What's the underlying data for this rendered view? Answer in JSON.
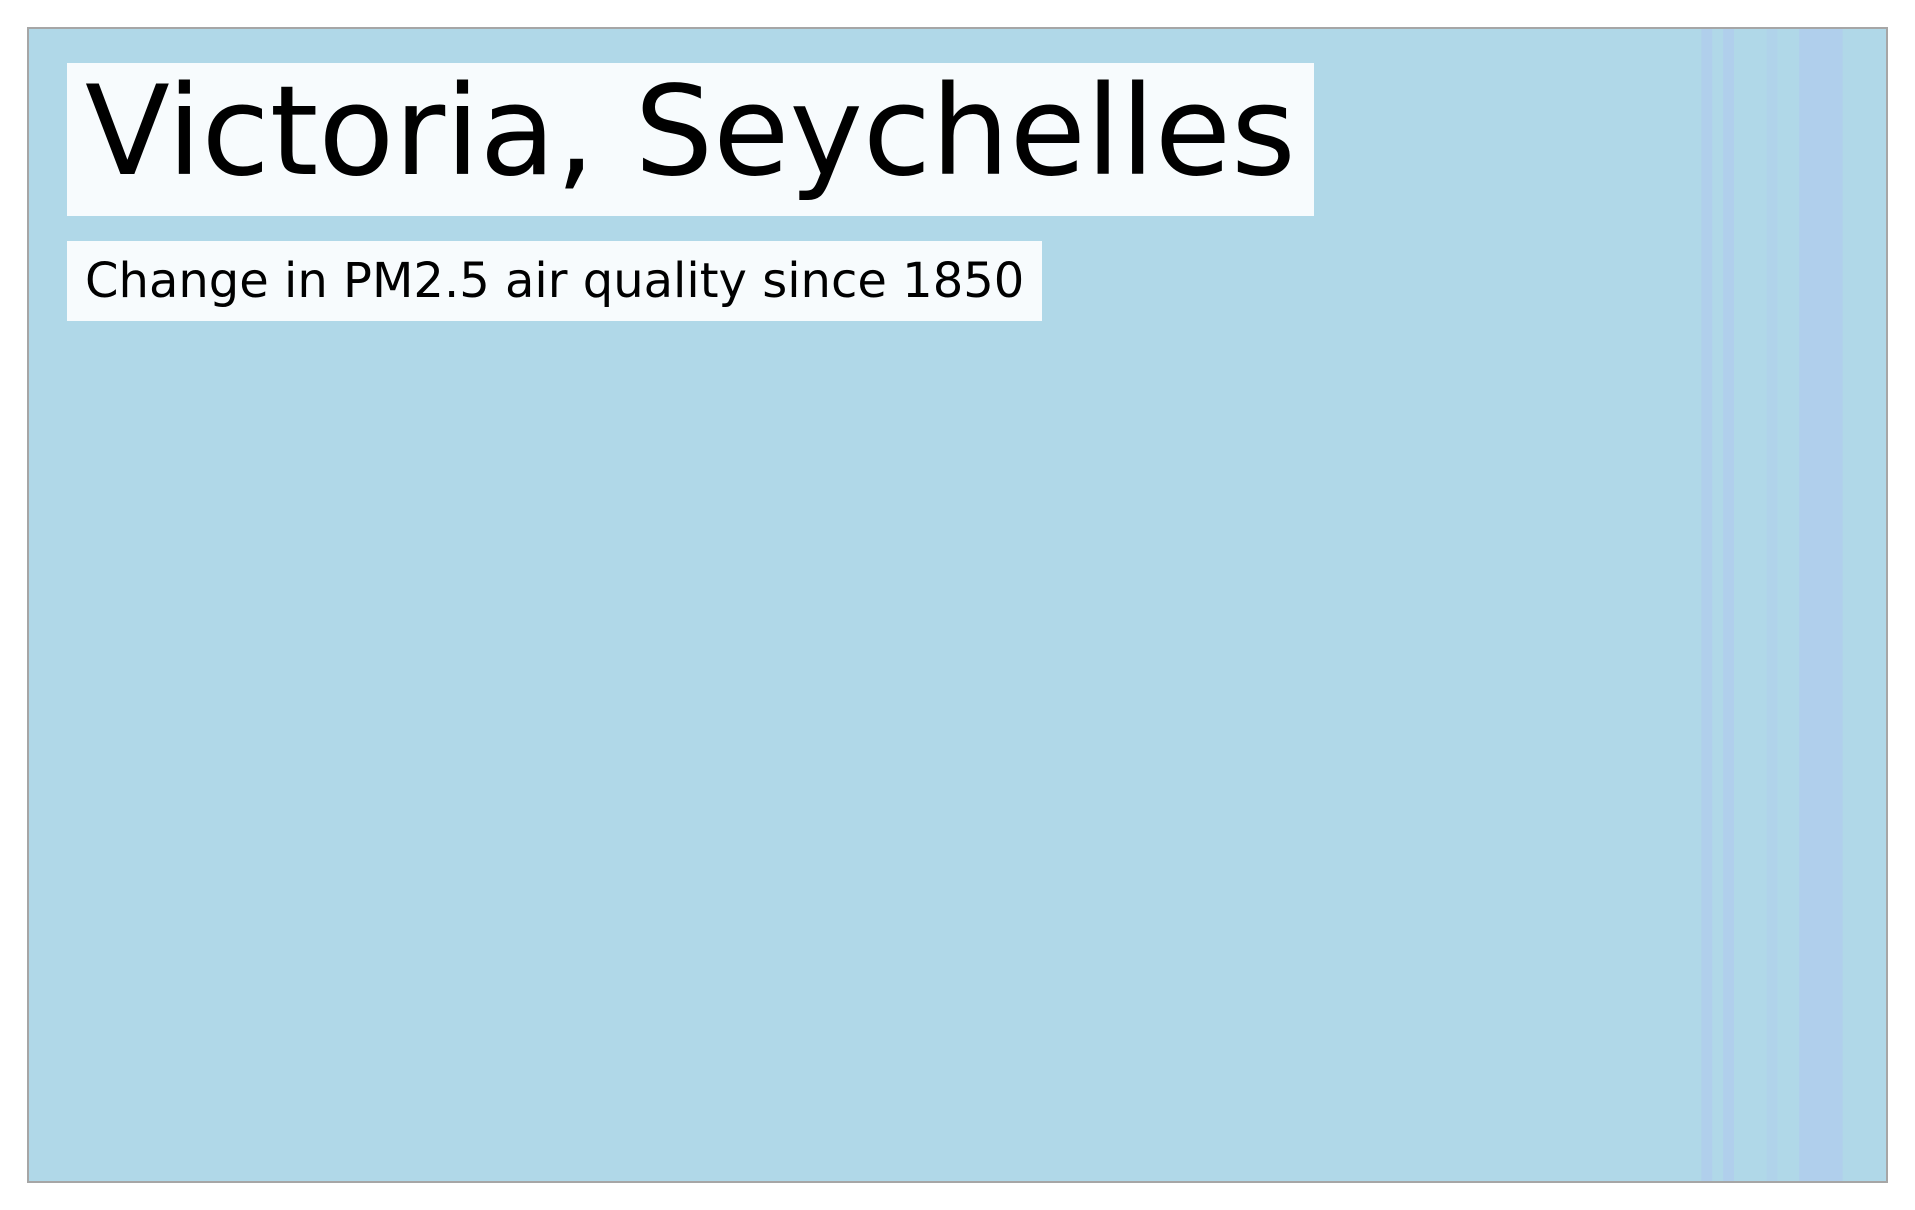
{
  "chart_data": {
    "type": "heatmap",
    "title": "Victoria, Seychelles",
    "subtitle": "Change in PM2.5 air quality since 1850",
    "x_range": [
      1850,
      2021
    ],
    "colors": {
      "near_zero_change": "#b0d8e8",
      "slight_increase": "#b0cfec"
    },
    "stripes": [
      {
        "from": 2004,
        "to": 2005,
        "color": "#b0cfec"
      },
      {
        "from": 2006,
        "to": 2007,
        "color": "#b0cfec"
      },
      {
        "from": 2010,
        "to": 2011,
        "color": "#b0d3ea"
      },
      {
        "from": 2013,
        "to": 2017,
        "color": "#b0cfec"
      }
    ]
  }
}
